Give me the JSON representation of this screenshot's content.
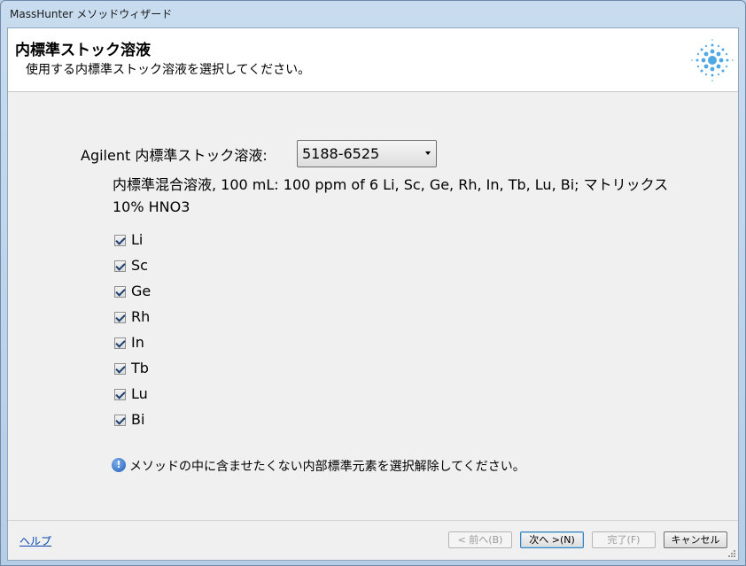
{
  "window": {
    "title": "MassHunter メソッドウィザード"
  },
  "header": {
    "title": "内標準ストック溶液",
    "subtitle": "使用する内標準ストック溶液を選択してください。"
  },
  "stock": {
    "label": "Agilent 内標準ストック溶液:",
    "selected": "5188-6525"
  },
  "description": "内標準混合溶液, 100 mL: 100 ppm of 6 Li, Sc, Ge, Rh, In, Tb, Lu, Bi;  マトリックス 10% HNO3",
  "elements": [
    {
      "label": "Li",
      "checked": true
    },
    {
      "label": "Sc",
      "checked": true
    },
    {
      "label": "Ge",
      "checked": true
    },
    {
      "label": "Rh",
      "checked": true
    },
    {
      "label": "In",
      "checked": true
    },
    {
      "label": "Tb",
      "checked": true
    },
    {
      "label": "Lu",
      "checked": true
    },
    {
      "label": "Bi",
      "checked": true
    }
  ],
  "note": {
    "icon": "info-icon",
    "text": "メソッドの中に含ませたくない内部標準元素を選択解除してください。"
  },
  "footer": {
    "help": "ヘルプ",
    "back": "< 前へ(B)",
    "next": "次へ >(N)",
    "finish": "完了(F)",
    "cancel": "キャンセル"
  },
  "colors": {
    "accent": "#1f5db8",
    "logo": "#4fa8e6"
  }
}
